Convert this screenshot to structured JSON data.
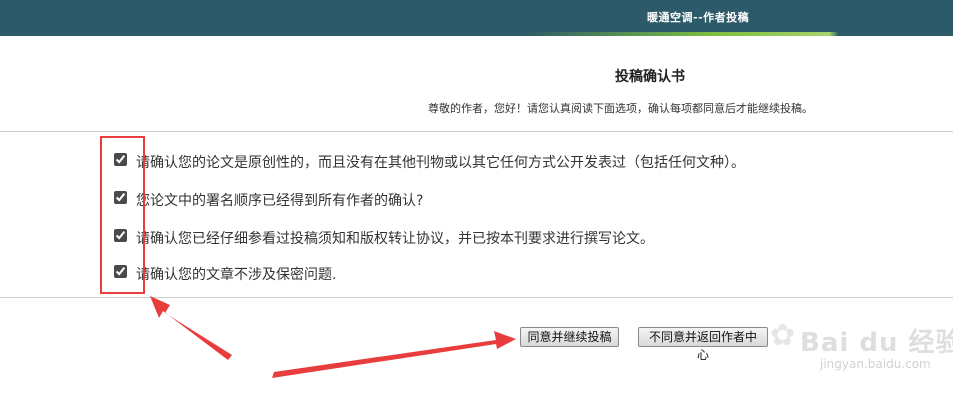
{
  "header": {
    "title": "暖通空调--作者投稿"
  },
  "page": {
    "heading": "投稿确认书",
    "subheading": "尊敬的作者，您好！请您认真阅读下面选项，确认每项都同意后才能继续投稿。"
  },
  "options": [
    {
      "label": "请确认您的论文是原创性的，而且没有在其他刊物或以其它任何方式公开发表过（包括任何文种）。",
      "checked": true
    },
    {
      "label": "您论文中的署名顺序已经得到所有作者的确认?",
      "checked": true
    },
    {
      "label": "请确认您已经仔细参看过投稿须知和版权转让协议，并已按本刊要求进行撰写论文。",
      "checked": true
    },
    {
      "label": "请确认您的文章不涉及保密问题.",
      "checked": true
    }
  ],
  "buttons": {
    "agree": "同意并继续投稿",
    "disagree": "不同意并返回作者中心"
  },
  "watermark": {
    "brand": "Bai du 经验",
    "url": "jingyan.baidu.com"
  },
  "colors": {
    "topbar": "#2c5a68",
    "accent_green": "#7fbf3f",
    "annotation_red": "#e93d3d"
  }
}
